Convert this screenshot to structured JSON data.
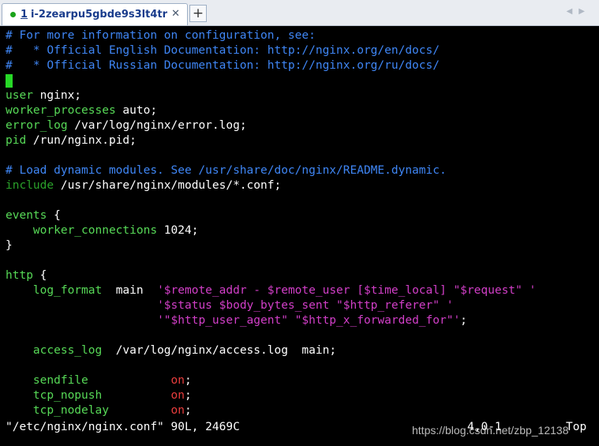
{
  "tab": {
    "number": "1",
    "title": "i-2zearpu5gbde9s3lt4tr",
    "close": "✕",
    "add": "+",
    "nav": "◀▶"
  },
  "colors": {
    "comment": "#3f86f5",
    "directive": "#57d957",
    "string": "#d23fc8",
    "on_value": "#e83d3d",
    "cursor": "#27d827",
    "background": "#000000"
  },
  "lines": {
    "l0": "# For more information on configuration, see:",
    "l1": "#   * Official English Documentation: http://nginx.org/en/docs/",
    "l2": "#   * Official Russian Documentation: http://nginx.org/ru/docs/",
    "l4_key": "user",
    "l4_val": " nginx;",
    "l5_key": "worker_processes",
    "l5_val": " auto;",
    "l6_key": "error_log",
    "l6_val": " /var/log/nginx/error.log;",
    "l7_key": "pid",
    "l7_val": " /run/nginx.pid;",
    "l9": "# Load dynamic modules. See /usr/share/doc/nginx/README.dynamic.",
    "l10_key": "include",
    "l10_val": " /usr/share/nginx/modules/*.conf;",
    "l12_key": "events",
    "l12_val": " {",
    "l13_indent": "    ",
    "l13_key": "worker_connections",
    "l13_val": " 1024;",
    "l14": "}",
    "l16_key": "http",
    "l16_val": " {",
    "l17_indent": "    ",
    "l17_key": "log_format",
    "l17_mid": "  main  ",
    "l17_str": "'$remote_addr - $remote_user [$time_local] \"$request\" '",
    "l18_indent": "                      ",
    "l18_str": "'$status $body_bytes_sent \"$http_referer\" '",
    "l19_indent": "                      ",
    "l19_str": "'\"$http_user_agent\" \"$http_x_forwarded_for\"'",
    "l19_end": ";",
    "l21_indent": "    ",
    "l21_key": "access_log",
    "l21_val": "  /var/log/nginx/access.log  main;",
    "l23_indent": "    ",
    "l23_key": "sendfile",
    "l23_pad": "            ",
    "l23_on": "on",
    "l23_end": ";",
    "l24_indent": "    ",
    "l24_key": "tcp_nopush",
    "l24_pad": "          ",
    "l24_on": "on",
    "l24_end": ";",
    "l25_indent": "    ",
    "l25_key": "tcp_nodelay",
    "l25_pad": "         ",
    "l25_on": "on",
    "l25_end": ";"
  },
  "status": {
    "file": "\"/etc/nginx/nginx.conf\" 90L, 2469C",
    "position": "4,0-1",
    "scroll": "Top"
  },
  "watermark": "https://blog.csdn.net/zbp_12138"
}
